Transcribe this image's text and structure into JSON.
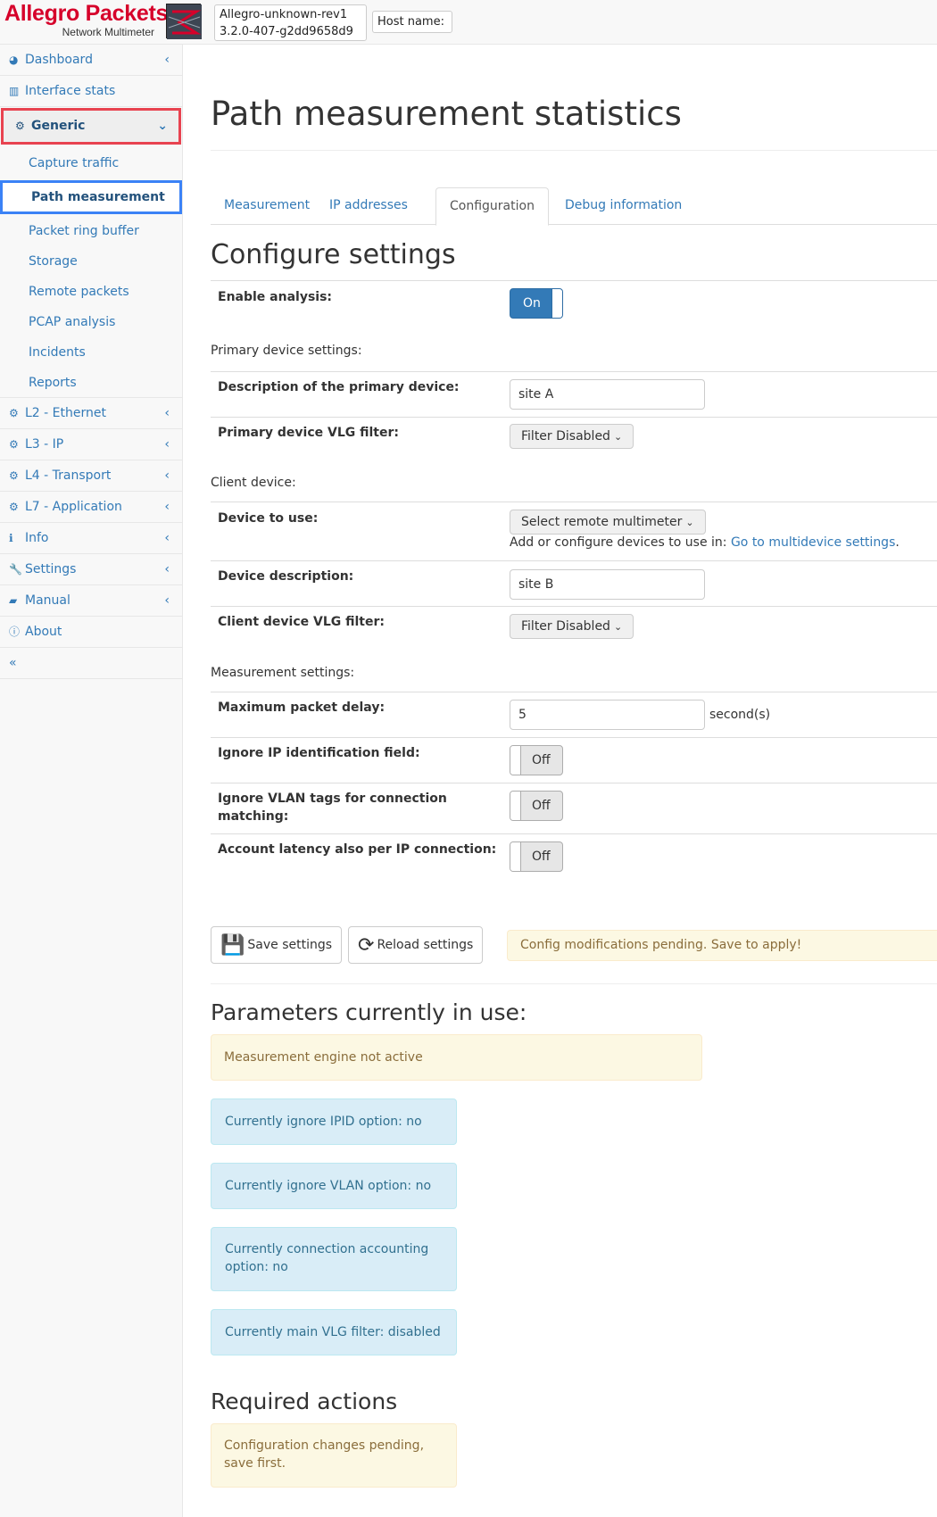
{
  "header": {
    "brand_name": "Allegro Packets",
    "brand_sub": "Network Multimeter",
    "device_line1": "Allegro-unknown-rev1",
    "device_line2": "3.2.0-407-g2dd9658d9",
    "host_label": "Host name:"
  },
  "sidebar": {
    "items": [
      {
        "label": "Dashboard",
        "icon": "dashboard-icon"
      },
      {
        "label": "Interface stats",
        "icon": "bar-chart-icon"
      },
      {
        "label": "Generic",
        "icon": "gear-icon"
      },
      {
        "label": "L2 - Ethernet",
        "icon": "gear-icon"
      },
      {
        "label": "L3 - IP",
        "icon": "gear-icon"
      },
      {
        "label": "L4 - Transport",
        "icon": "gear-icon"
      },
      {
        "label": "L7 - Application",
        "icon": "gear-icon"
      },
      {
        "label": "Info",
        "icon": "info-icon"
      },
      {
        "label": "Settings",
        "icon": "wrench-icon"
      },
      {
        "label": "Manual",
        "icon": "book-icon"
      },
      {
        "label": "About",
        "icon": "info-circle-icon"
      }
    ],
    "generic_sub": [
      "Capture traffic",
      "Path measurement",
      "Packet ring buffer",
      "Storage",
      "Remote packets",
      "PCAP analysis",
      "Incidents",
      "Reports"
    ],
    "collapse_symbol": "«"
  },
  "page": {
    "title": "Path measurement statistics",
    "tabs": [
      "Measurement",
      "IP addresses",
      "Configuration",
      "Debug information"
    ],
    "active_tab": "Configuration"
  },
  "config": {
    "heading": "Configure settings",
    "enable_analysis_label": "Enable analysis:",
    "enable_analysis_value": "On",
    "primary_section": "Primary device settings:",
    "primary_desc_label": "Description of the primary device:",
    "primary_desc_value": "site A",
    "primary_vlg_label": "Primary device VLG filter:",
    "primary_vlg_value": "Filter Disabled",
    "client_section": "Client device:",
    "device_to_use_label": "Device to use:",
    "device_to_use_value": "Select remote multimeter",
    "device_help_prefix": "Add or configure devices to use in: ",
    "device_help_link": "Go to multidevice settings",
    "device_help_suffix": ".",
    "device_desc_label": "Device description:",
    "device_desc_value": "site B",
    "client_vlg_label": "Client device VLG filter:",
    "client_vlg_value": "Filter Disabled",
    "measurement_section": "Measurement settings:",
    "max_delay_label": "Maximum packet delay:",
    "max_delay_value": "5",
    "max_delay_unit": "second(s)",
    "ignore_ipid_label": "Ignore IP identification field:",
    "ignore_ipid_value": "Off",
    "ignore_vlan_label": "Ignore VLAN tags for connection matching:",
    "ignore_vlan_value": "Off",
    "account_latency_label": "Account latency also per IP connection:",
    "account_latency_value": "Off",
    "save_label": "Save settings",
    "reload_label": "Reload settings",
    "pending_msg": "Config modifications pending. Save to apply!"
  },
  "params": {
    "heading": "Parameters currently in use:",
    "engine_status": "Measurement engine not active",
    "info": [
      "Currently ignore IPID option: no",
      "Currently ignore VLAN option: no",
      "Currently connection accounting option: no",
      "Currently main VLG filter: disabled"
    ]
  },
  "required": {
    "heading": "Required actions",
    "message": "Configuration changes pending, save first."
  }
}
